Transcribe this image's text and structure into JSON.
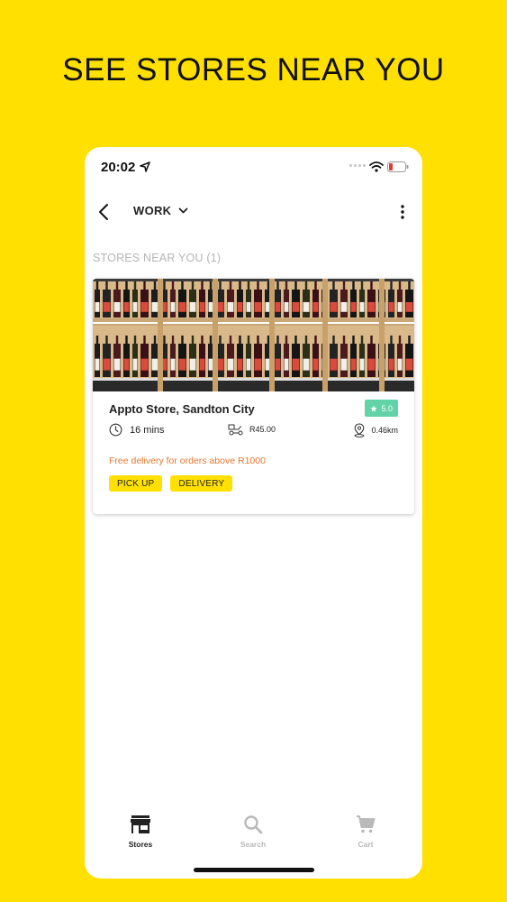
{
  "headline": "SEE STORES NEAR YOU",
  "status_bar": {
    "time": "20:02"
  },
  "nav": {
    "location_label": "WORK"
  },
  "section": {
    "title": "STORES NEAR YOU (1)"
  },
  "stores": [
    {
      "name": "Appto Store, Sandton City",
      "rating": "5.0",
      "eta": "16  mins",
      "delivery_fee": "R45.00",
      "distance": "0.46km",
      "note": "Free delivery for orders above R1000",
      "tags": [
        "PICK UP",
        "DELIVERY"
      ]
    }
  ],
  "tab_bar": {
    "items": [
      {
        "label": "Stores",
        "icon": "storefront-icon",
        "active": true
      },
      {
        "label": "Search",
        "icon": "search-icon",
        "active": false
      },
      {
        "label": "Cart",
        "icon": "cart-icon",
        "active": false
      }
    ]
  },
  "colors": {
    "brand_yellow": "#FFE000",
    "rating_green": "#62D3A6",
    "note_orange": "#E8772E"
  }
}
